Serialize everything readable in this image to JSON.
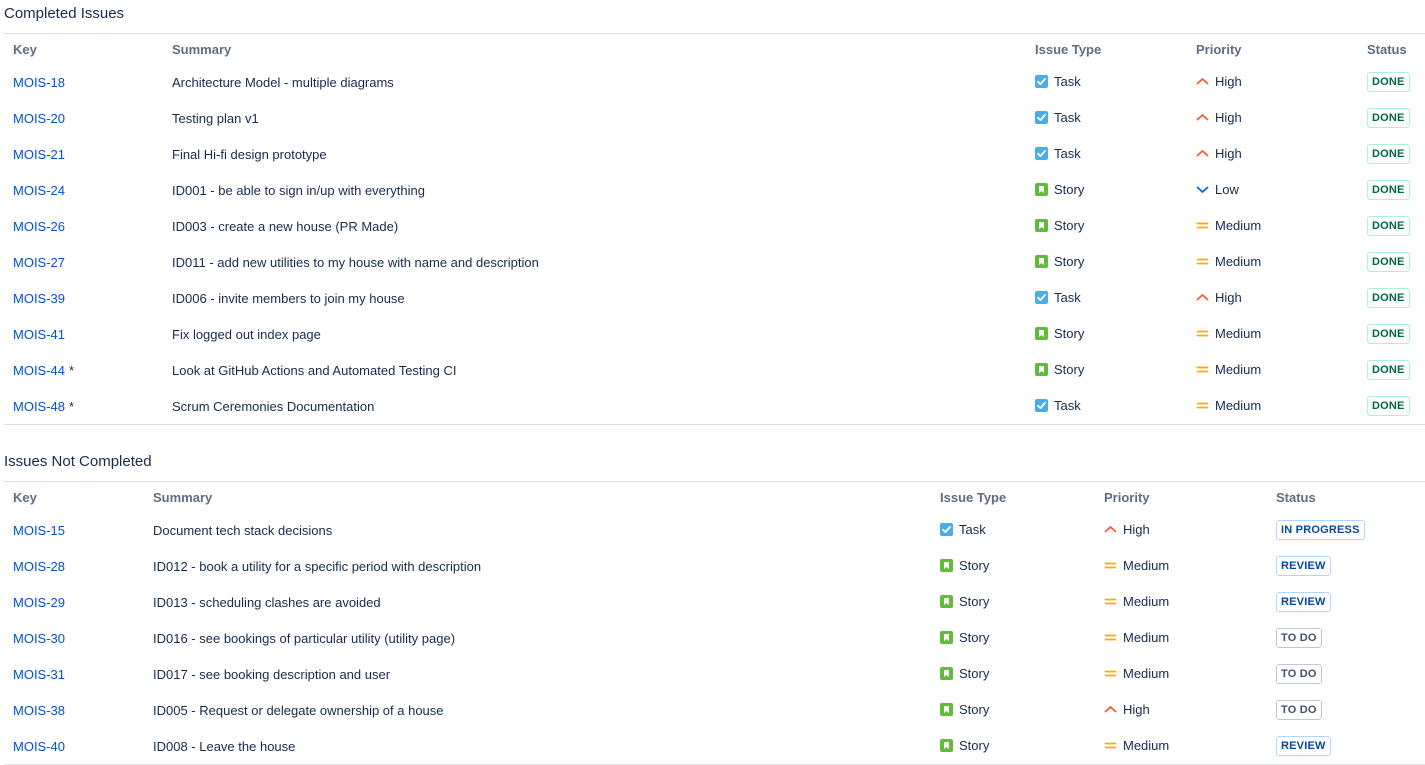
{
  "completed": {
    "title": "Completed Issues",
    "headers": {
      "key": "Key",
      "summary": "Summary",
      "type": "Issue Type",
      "priority": "Priority",
      "status": "Status"
    },
    "rows": [
      {
        "key": "MOIS-18",
        "star": "",
        "summary": "Architecture Model - multiple diagrams",
        "type": "Task",
        "priority": "High",
        "status": "DONE"
      },
      {
        "key": "MOIS-20",
        "star": "",
        "summary": "Testing plan v1",
        "type": "Task",
        "priority": "High",
        "status": "DONE"
      },
      {
        "key": "MOIS-21",
        "star": "",
        "summary": "Final Hi-fi design prototype",
        "type": "Task",
        "priority": "High",
        "status": "DONE"
      },
      {
        "key": "MOIS-24",
        "star": "",
        "summary": "ID001 - be able to sign in/up with everything",
        "type": "Story",
        "priority": "Low",
        "status": "DONE"
      },
      {
        "key": "MOIS-26",
        "star": "",
        "summary": "ID003 - create a new house (PR Made)",
        "type": "Story",
        "priority": "Medium",
        "status": "DONE"
      },
      {
        "key": "MOIS-27",
        "star": "",
        "summary": "ID011 - add new utilities to my house with name and description",
        "type": "Story",
        "priority": "Medium",
        "status": "DONE"
      },
      {
        "key": "MOIS-39",
        "star": "",
        "summary": "ID006 - invite members to join my house",
        "type": "Task",
        "priority": "High",
        "status": "DONE"
      },
      {
        "key": "MOIS-41",
        "star": "",
        "summary": "Fix logged out index page",
        "type": "Story",
        "priority": "Medium",
        "status": "DONE"
      },
      {
        "key": "MOIS-44",
        "star": "*",
        "summary": "Look at GitHub Actions and Automated Testing CI",
        "type": "Story",
        "priority": "Medium",
        "status": "DONE"
      },
      {
        "key": "MOIS-48",
        "star": "*",
        "summary": "Scrum Ceremonies Documentation",
        "type": "Task",
        "priority": "Medium",
        "status": "DONE"
      }
    ]
  },
  "not_completed": {
    "title": "Issues Not Completed",
    "headers": {
      "key": "Key",
      "summary": "Summary",
      "type": "Issue Type",
      "priority": "Priority",
      "status": "Status"
    },
    "rows": [
      {
        "key": "MOIS-15",
        "star": "",
        "summary": "Document tech stack decisions",
        "type": "Task",
        "priority": "High",
        "status": "IN PROGRESS"
      },
      {
        "key": "MOIS-28",
        "star": "",
        "summary": "ID012 - book a utility for a specific period with description",
        "type": "Story",
        "priority": "Medium",
        "status": "REVIEW"
      },
      {
        "key": "MOIS-29",
        "star": "",
        "summary": "ID013 - scheduling clashes are avoided",
        "type": "Story",
        "priority": "Medium",
        "status": "REVIEW"
      },
      {
        "key": "MOIS-30",
        "star": "",
        "summary": "ID016 - see bookings of particular utility (utility page)",
        "type": "Story",
        "priority": "Medium",
        "status": "TO DO"
      },
      {
        "key": "MOIS-31",
        "star": "",
        "summary": "ID017 - see booking description and user",
        "type": "Story",
        "priority": "Medium",
        "status": "TO DO"
      },
      {
        "key": "MOIS-38",
        "star": "",
        "summary": "ID005 - Request or delegate ownership of a house",
        "type": "Story",
        "priority": "High",
        "status": "TO DO"
      },
      {
        "key": "MOIS-40",
        "star": "",
        "summary": "ID008 - Leave the house",
        "type": "Story",
        "priority": "Medium",
        "status": "REVIEW"
      }
    ]
  },
  "icons": {
    "Task": "task-checkbox-icon",
    "Story": "story-bookmark-icon",
    "High": "priority-high-chevron-icon",
    "Medium": "priority-medium-equals-icon",
    "Low": "priority-low-chevron-icon"
  },
  "colors": {
    "link": "#0052cc",
    "task": "#4bade8",
    "story": "#63ba3c",
    "high": "#ff5630",
    "medium": "#ffab00",
    "low": "#0065ff",
    "done": "#006644",
    "inprogress": "#0747a6",
    "todo": "#42526e"
  }
}
